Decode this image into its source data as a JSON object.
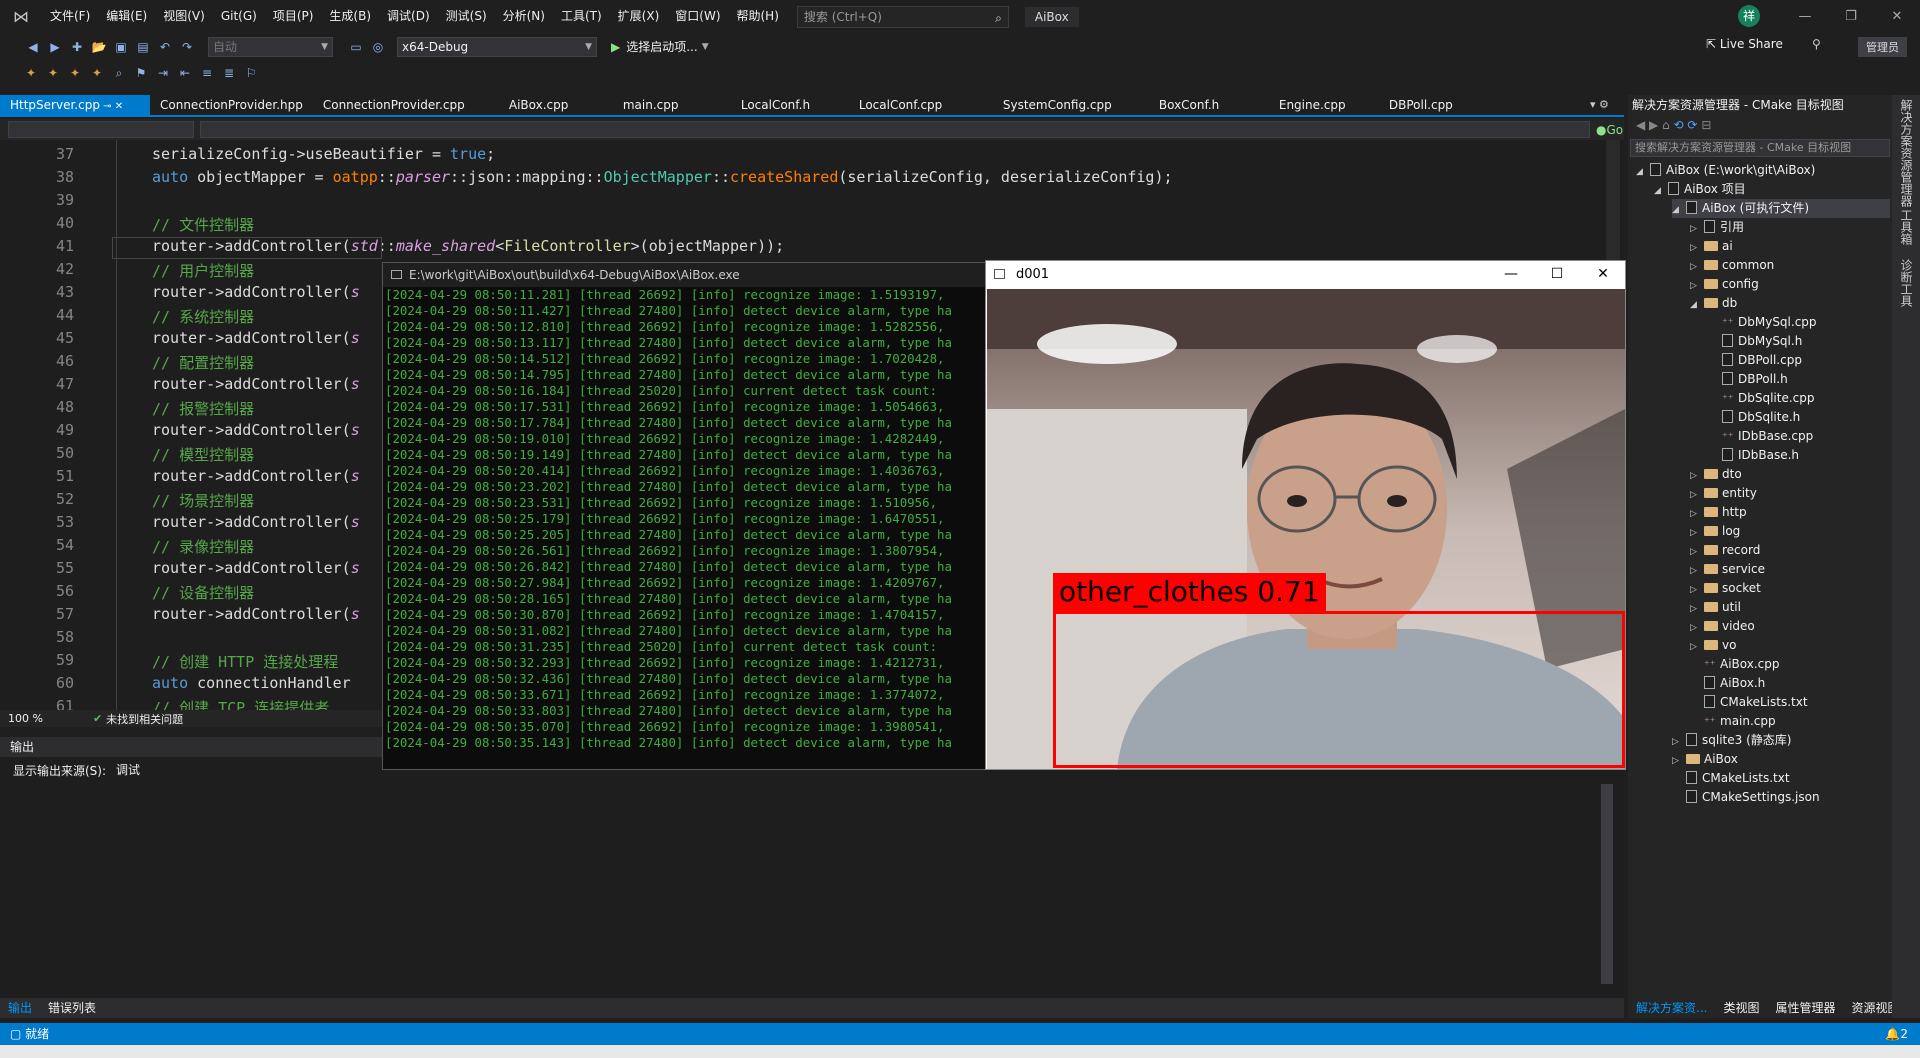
{
  "menubar": {
    "items": [
      "文件(F)",
      "编辑(E)",
      "视图(V)",
      "Git(G)",
      "项目(P)",
      "生成(B)",
      "调试(D)",
      "测试(S)",
      "分析(N)",
      "工具(T)",
      "扩展(X)",
      "窗口(W)",
      "帮助(H)"
    ],
    "search_placeholder": "搜索 (Ctrl+Q)",
    "app_name": "AiBox",
    "avatar": "祥"
  },
  "toolbar": {
    "config_combo": "自动",
    "platform_combo": "x64-Debug",
    "start_label": "选择启动项...",
    "live_share": "Live Share",
    "admin": "管理员"
  },
  "tabs": [
    "HttpServer.cpp",
    "ConnectionProvider.hpp",
    "ConnectionProvider.cpp",
    "AiBox.cpp",
    "main.cpp",
    "LocalConf.h",
    "LocalConf.cpp",
    "SystemConfig.cpp",
    "BoxConf.h",
    "Engine.cpp",
    "DBPoll.cpp"
  ],
  "nav_right": "Go",
  "editor": {
    "lines": [
      {
        "n": "37",
        "html": "serializeConfig-&gt;useBeautifier = <span class=\"kw\">true</span>;"
      },
      {
        "n": "38",
        "html": "<span class=\"kw\">auto</span> objectMapper = <span class=\"fn\">oatpp</span>::<span class=\"it\">parser</span>::json::mapping::<span class=\"ty\">ObjectMapper</span>::<span class=\"fn\">createShared</span>(serializeConfig, deserializeConfig);"
      },
      {
        "n": "39",
        "html": ""
      },
      {
        "n": "40",
        "html": "<span class=\"cm\">// 文件控制器</span>"
      },
      {
        "n": "41",
        "html": "router-&gt;addController(<span class=\"it\">std</span>::<span class=\"it\">make_shared</span>&lt;<span class=\"ns\">FileController</span>&gt;(objectMapper));"
      },
      {
        "n": "42",
        "html": "<span class=\"cm\">// 用户控制器</span>"
      },
      {
        "n": "43",
        "html": "router-&gt;addController(<span class=\"it\">s</span>"
      },
      {
        "n": "44",
        "html": "<span class=\"cm\">// 系统控制器</span>"
      },
      {
        "n": "45",
        "html": "router-&gt;addController(<span class=\"it\">s</span>"
      },
      {
        "n": "46",
        "html": "<span class=\"cm\">// 配置控制器</span>"
      },
      {
        "n": "47",
        "html": "router-&gt;addController(<span class=\"it\">s</span>"
      },
      {
        "n": "48",
        "html": "<span class=\"cm\">// 报警控制器</span>"
      },
      {
        "n": "49",
        "html": "router-&gt;addController(<span class=\"it\">s</span>"
      },
      {
        "n": "50",
        "html": "<span class=\"cm\">// 模型控制器</span>"
      },
      {
        "n": "51",
        "html": "router-&gt;addController(<span class=\"it\">s</span>"
      },
      {
        "n": "52",
        "html": "<span class=\"cm\">// 场景控制器</span>"
      },
      {
        "n": "53",
        "html": "router-&gt;addController(<span class=\"it\">s</span>"
      },
      {
        "n": "54",
        "html": "<span class=\"cm\">// 录像控制器</span>"
      },
      {
        "n": "55",
        "html": "router-&gt;addController(<span class=\"it\">s</span>"
      },
      {
        "n": "56",
        "html": "<span class=\"cm\">// 设备控制器</span>"
      },
      {
        "n": "57",
        "html": "router-&gt;addController(<span class=\"it\">s</span>"
      },
      {
        "n": "58",
        "html": ""
      },
      {
        "n": "59",
        "html": "<span class=\"cm\">// 创建 HTTP 连接处理程</span>"
      },
      {
        "n": "60",
        "html": "<span class=\"kw\">auto</span> connectionHandler"
      },
      {
        "n": "61",
        "html": "<span class=\"cm\">// 创建 TCP 连接提供者</span>"
      }
    ]
  },
  "status_line": {
    "zoom": "100 %",
    "issues": "未找到相关问题"
  },
  "output": {
    "title": "输出",
    "source_label": "显示输出来源(S):",
    "source_value": "调试"
  },
  "bottom_tabs": [
    "输出",
    "错误列表"
  ],
  "console": {
    "title": "E:\\work\\git\\AiBox\\out\\build\\x64-Debug\\AiBox\\AiBox.exe",
    "lines": [
      "[2024-04-29 08:50:11.281] [thread 26692] [info] recognize image: 1.5193197,",
      "[2024-04-29 08:50:11.427] [thread 27480] [info] detect device alarm, type ha",
      "[2024-04-29 08:50:12.810] [thread 26692] [info] recognize image: 1.5282556,",
      "[2024-04-29 08:50:13.117] [thread 27480] [info] detect device alarm, type ha",
      "[2024-04-29 08:50:14.512] [thread 26692] [info] recognize image: 1.7020428,",
      "[2024-04-29 08:50:14.795] [thread 27480] [info] detect device alarm, type ha",
      "[2024-04-29 08:50:16.184] [thread 25020] [info] current detect task count:",
      "[2024-04-29 08:50:17.531] [thread 26692] [info] recognize image: 1.5054663,",
      "[2024-04-29 08:50:17.784] [thread 27480] [info] detect device alarm, type ha",
      "[2024-04-29 08:50:19.010] [thread 26692] [info] recognize image: 1.4282449,",
      "[2024-04-29 08:50:19.149] [thread 27480] [info] detect device alarm, type ha",
      "[2024-04-29 08:50:20.414] [thread 26692] [info] recognize image: 1.4036763,",
      "[2024-04-29 08:50:23.202] [thread 27480] [info] detect device alarm, type ha",
      "[2024-04-29 08:50:23.531] [thread 26692] [info] recognize image: 1.510956,",
      "[2024-04-29 08:50:25.179] [thread 26692] [info] recognize image: 1.6470551,",
      "[2024-04-29 08:50:25.205] [thread 27480] [info] detect device alarm, type ha",
      "[2024-04-29 08:50:26.561] [thread 26692] [info] recognize image: 1.3807954,",
      "[2024-04-29 08:50:26.842] [thread 27480] [info] detect device alarm, type ha",
      "[2024-04-29 08:50:27.984] [thread 26692] [info] recognize image: 1.4209767,",
      "[2024-04-29 08:50:28.165] [thread 27480] [info] detect device alarm, type ha",
      "[2024-04-29 08:50:30.870] [thread 26692] [info] recognize image: 1.4704157,",
      "[2024-04-29 08:50:31.082] [thread 27480] [info] detect device alarm, type ha",
      "[2024-04-29 08:50:31.235] [thread 25020] [info] current detect task count:",
      "[2024-04-29 08:50:32.293] [thread 26692] [info] recognize image: 1.4212731,",
      "[2024-04-29 08:50:32.436] [thread 27480] [info] detect device alarm, type ha",
      "[2024-04-29 08:50:33.671] [thread 26692] [info] recognize image: 1.3774072,",
      "[2024-04-29 08:50:33.803] [thread 27480] [info] detect device alarm, type ha",
      "[2024-04-29 08:50:35.070] [thread 26692] [info] recognize image: 1.3980541,",
      "[2024-04-29 08:50:35.143] [thread 27480] [info] detect device alarm, type ha"
    ]
  },
  "camera": {
    "title": "d001",
    "detection_label": "other_clothes 0.71"
  },
  "solution": {
    "title": "解决方案资源管理器 - CMake 目标视图",
    "search_placeholder": "搜索解决方案资源管理器 - CMake 目标视图",
    "tree": [
      {
        "label": "AiBox (E:\\work\\git\\AiBox)",
        "indent": 0,
        "kind": "root",
        "tri": "◢"
      },
      {
        "label": "AiBox 项目",
        "indent": 1,
        "kind": "proj",
        "tri": "◢"
      },
      {
        "label": "AiBox (可执行文件)",
        "indent": 2,
        "kind": "exe",
        "tri": "◢",
        "selected": true
      },
      {
        "label": "引用",
        "indent": 3,
        "kind": "ref",
        "tri": "▷"
      },
      {
        "label": "ai",
        "indent": 3,
        "kind": "folder",
        "tri": "▷"
      },
      {
        "label": "common",
        "indent": 3,
        "kind": "folder",
        "tri": "▷"
      },
      {
        "label": "config",
        "indent": 3,
        "kind": "folder",
        "tri": "▷"
      },
      {
        "label": "db",
        "indent": 3,
        "kind": "folder",
        "tri": "◢"
      },
      {
        "label": "DbMySql.cpp",
        "indent": 4,
        "kind": "cpp",
        "tri": ""
      },
      {
        "label": "DbMySql.h",
        "indent": 4,
        "kind": "h",
        "tri": ""
      },
      {
        "label": "DBPoll.cpp",
        "indent": 4,
        "kind": "h",
        "tri": ""
      },
      {
        "label": "DBPoll.h",
        "indent": 4,
        "kind": "h",
        "tri": ""
      },
      {
        "label": "DbSqlite.cpp",
        "indent": 4,
        "kind": "cpp",
        "tri": ""
      },
      {
        "label": "DbSqlite.h",
        "indent": 4,
        "kind": "h",
        "tri": ""
      },
      {
        "label": "IDbBase.cpp",
        "indent": 4,
        "kind": "cpp",
        "tri": ""
      },
      {
        "label": "IDbBase.h",
        "indent": 4,
        "kind": "h",
        "tri": ""
      },
      {
        "label": "dto",
        "indent": 3,
        "kind": "folder",
        "tri": "▷"
      },
      {
        "label": "entity",
        "indent": 3,
        "kind": "folder",
        "tri": "▷"
      },
      {
        "label": "http",
        "indent": 3,
        "kind": "folder",
        "tri": "▷"
      },
      {
        "label": "log",
        "indent": 3,
        "kind": "folder",
        "tri": "▷"
      },
      {
        "label": "record",
        "indent": 3,
        "kind": "folder",
        "tri": "▷"
      },
      {
        "label": "service",
        "indent": 3,
        "kind": "folder",
        "tri": "▷"
      },
      {
        "label": "socket",
        "indent": 3,
        "kind": "folder",
        "tri": "▷"
      },
      {
        "label": "util",
        "indent": 3,
        "kind": "folder",
        "tri": "▷"
      },
      {
        "label": "video",
        "indent": 3,
        "kind": "folder",
        "tri": "▷"
      },
      {
        "label": "vo",
        "indent": 3,
        "kind": "folder",
        "tri": "▷"
      },
      {
        "label": "AiBox.cpp",
        "indent": 3,
        "kind": "cpp",
        "tri": ""
      },
      {
        "label": "AiBox.h",
        "indent": 3,
        "kind": "h",
        "tri": ""
      },
      {
        "label": "CMakeLists.txt",
        "indent": 3,
        "kind": "h",
        "tri": ""
      },
      {
        "label": "main.cpp",
        "indent": 3,
        "kind": "cpp",
        "tri": ""
      },
      {
        "label": "sqlite3 (静态库)",
        "indent": 2,
        "kind": "lib",
        "tri": "▷"
      },
      {
        "label": "AiBox",
        "indent": 2,
        "kind": "folder",
        "tri": "▷"
      },
      {
        "label": "CMakeLists.txt",
        "indent": 2,
        "kind": "h",
        "tri": ""
      },
      {
        "label": "CMakeSettings.json",
        "indent": 2,
        "kind": "h",
        "tri": ""
      }
    ],
    "tabs": [
      "解决方案资...",
      "类视图",
      "属性管理器",
      "资源视图"
    ]
  },
  "side_strip": [
    "解决方案资源管理器",
    "工具箱",
    "诊断工具"
  ],
  "statusbar": {
    "text": "就绪",
    "notif": "2"
  }
}
